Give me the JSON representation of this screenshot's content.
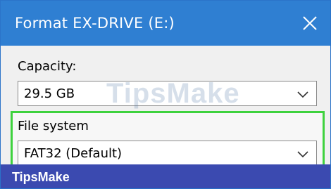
{
  "window": {
    "title": "Format EX-DRIVE (E:)",
    "close_icon": "close-icon"
  },
  "capacity": {
    "label": "Capacity:",
    "selected": "29.5 GB"
  },
  "file_system": {
    "label": "File system",
    "selected": "FAT32 (Default)",
    "highlight_color": "#3ed23e"
  },
  "watermark": {
    "text": "TipsMake"
  },
  "footer": {
    "brand": "TipsMake"
  },
  "colors": {
    "titlebar": "#2f7fd2",
    "footer": "#3b4ab0",
    "dialog_bg": "#f0f0f0"
  }
}
